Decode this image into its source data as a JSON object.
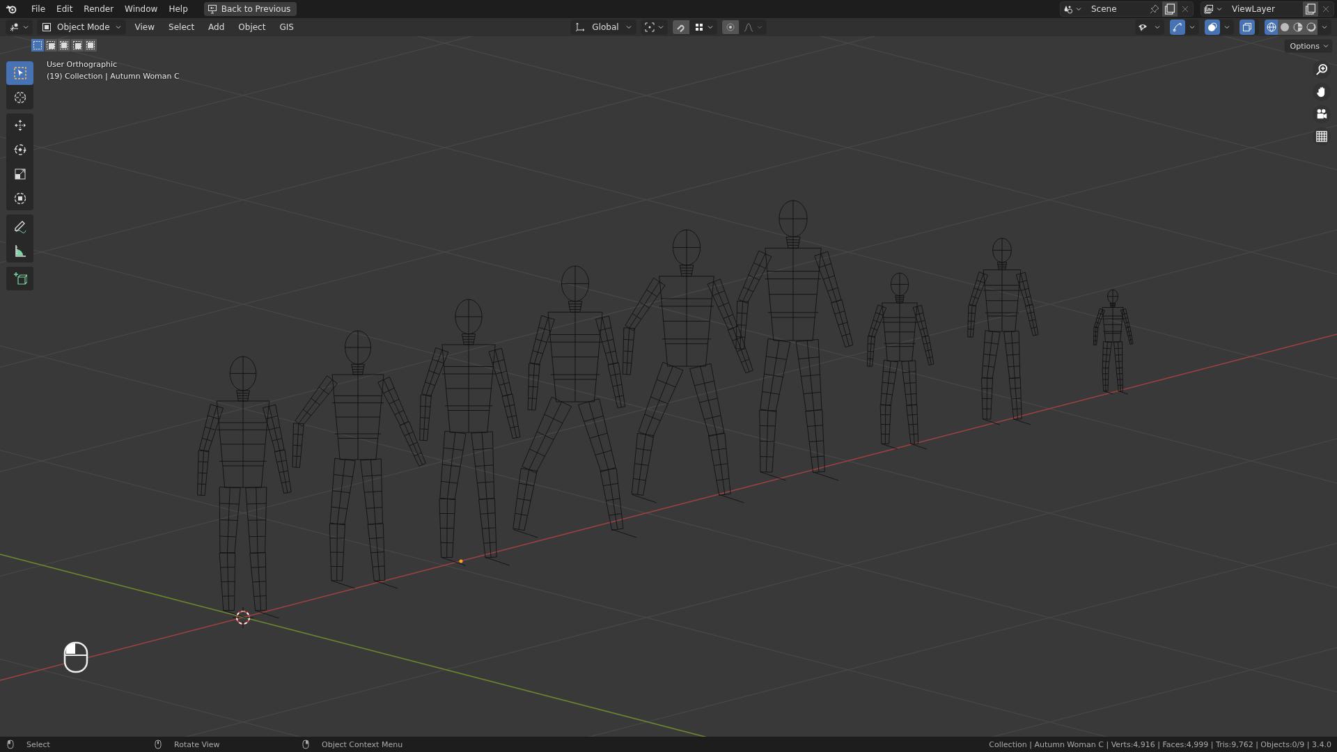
{
  "menu": [
    "File",
    "Edit",
    "Render",
    "Window",
    "Help"
  ],
  "back_button": "Back to Previous",
  "scene": {
    "name": "Scene"
  },
  "view_layer": {
    "name": "ViewLayer"
  },
  "header": {
    "mode": "Object Mode",
    "menus": [
      "View",
      "Select",
      "Add",
      "Object",
      "GIS"
    ],
    "orientation": "Global",
    "toggles": [
      {
        "kind": "visibility",
        "on": false
      },
      {
        "kind": "gizmo",
        "on": true
      },
      {
        "kind": "overlay",
        "on": true
      },
      {
        "kind": "xray",
        "on": true
      }
    ],
    "shading": [
      {
        "kind": "wireframe",
        "selected": true
      },
      {
        "kind": "solid",
        "selected": false
      },
      {
        "kind": "material",
        "selected": false
      },
      {
        "kind": "rendered",
        "selected": false
      }
    ],
    "options": "Options"
  },
  "select_modes": [
    {
      "selected": true
    },
    {
      "selected": false
    },
    {
      "selected": false
    },
    {
      "selected": false
    },
    {
      "selected": false
    }
  ],
  "viewport": {
    "view_name": "User Orthographic",
    "collection": "(19) Collection | Autumn Woman C"
  },
  "tool_groups": [
    {
      "tools": [
        {
          "kind": "select",
          "selected": true
        },
        {
          "kind": "cursor",
          "selected": false
        }
      ]
    },
    {
      "tools": [
        {
          "kind": "move",
          "selected": false
        },
        {
          "kind": "rotate",
          "selected": false
        },
        {
          "kind": "scale",
          "selected": false
        },
        {
          "kind": "transform",
          "selected": false
        }
      ]
    },
    {
      "tools": [
        {
          "kind": "annotate",
          "selected": false
        },
        {
          "kind": "measure",
          "selected": false
        }
      ]
    },
    {
      "tools": [
        {
          "kind": "add",
          "selected": false
        }
      ]
    }
  ],
  "status_bar": {
    "hints": [
      "Select",
      "Rotate View",
      "Object Context Menu"
    ],
    "stats": "Collection | Autumn Woman C | Verts:4,916 | Faces:4,999 | Tris:9,762 | Objects:0/9 | 3.4.0"
  }
}
